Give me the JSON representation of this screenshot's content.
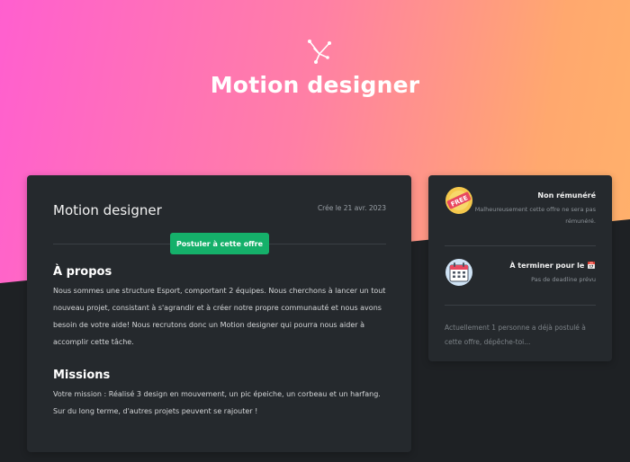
{
  "hero": {
    "title": "Motion designer"
  },
  "offer": {
    "title": "Motion designer",
    "created": "Crée le 21 avr. 2023",
    "apply_label": "Postuler à cette offre",
    "about_title": "À propos",
    "about_text": "Nous sommes une structure Esport, comportant 2 équipes. Nous cherchons à lancer un tout nouveau projet, consistant à s'agrandir et à créer notre propre communauté et nous avons besoin de votre aide! Nous recrutons donc un Motion designer qui pourra nous aider à accomplir cette tâche.",
    "missions_title": "Missions",
    "missions_text": "Votre mission : Réalisé 3 design en mouvement, un pic épeiche, un corbeau et un harfang. Sur du long terme, d'autres projets peuvent se rajouter !"
  },
  "sidebar": {
    "pay_heading": "Non rémunéré",
    "pay_sub": "Malheureusement cette offre ne sera pas rémunéré.",
    "deadline_heading": "À terminer pour le 📅",
    "deadline_sub": "Pas de deadline prévu",
    "applicants_note": "Actuellement 1 personne a déjà postulé à cette offre, dépêche-toi..."
  },
  "icons": {
    "logo": "star-constellation-icon",
    "free": "free-badge-icon",
    "calendar": "calendar-icon"
  },
  "colors": {
    "gradient_start": "#ff5fcf",
    "gradient_end": "#ffb36a",
    "accent": "#15b06a",
    "card": "#25292d",
    "background": "#1e2124"
  }
}
